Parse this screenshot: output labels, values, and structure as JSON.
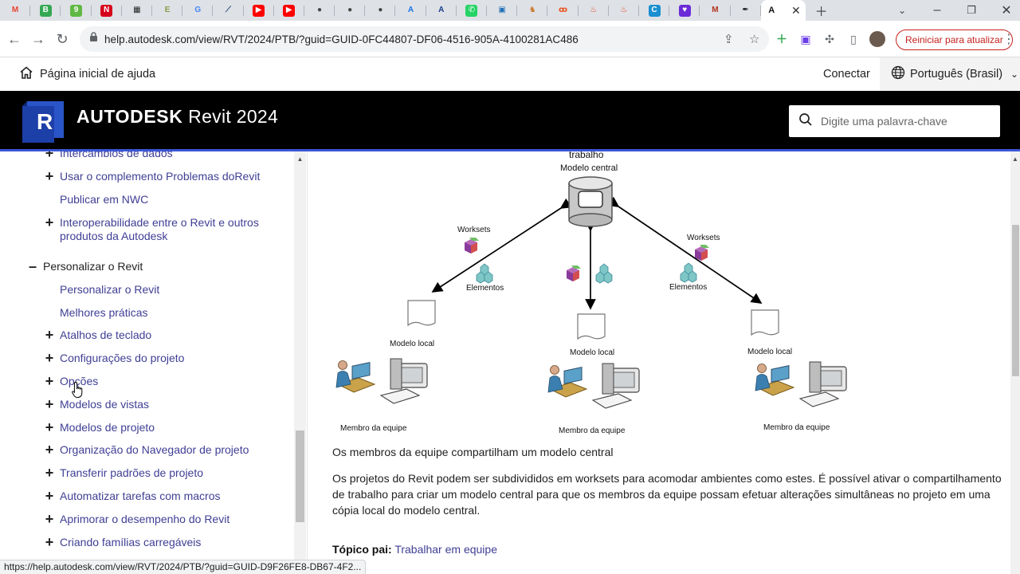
{
  "browser": {
    "tabs": [
      {
        "icon": "gmail-icon",
        "glyph": "M",
        "color": "#ea4335",
        "bg": "transparent"
      },
      {
        "icon": "b-site-icon",
        "glyph": "B",
        "color": "#fff",
        "bg": "#34a853"
      },
      {
        "icon": "9-site-icon",
        "glyph": "9",
        "color": "#fff",
        "bg": "#5fb843"
      },
      {
        "icon": "n-site-icon",
        "glyph": "N",
        "color": "#fff",
        "bg": "#d6001c"
      },
      {
        "icon": "grid-site-icon",
        "glyph": "▦",
        "color": "#222",
        "bg": "transparent"
      },
      {
        "icon": "e-site-icon",
        "glyph": "E",
        "color": "#8b9b4c",
        "bg": "transparent"
      },
      {
        "icon": "google-icon",
        "glyph": "G",
        "color": "#4285f4",
        "bg": "transparent"
      },
      {
        "icon": "stripe-site-icon",
        "glyph": "⟋",
        "color": "#2b4a7a",
        "bg": "transparent"
      },
      {
        "icon": "youtube-icon",
        "glyph": "▶",
        "color": "#fff",
        "bg": "#ff0000"
      },
      {
        "icon": "youtube-icon",
        "glyph": "▶",
        "color": "#fff",
        "bg": "#ff0000"
      },
      {
        "icon": "github-icon",
        "glyph": "●",
        "color": "#444",
        "bg": "transparent"
      },
      {
        "icon": "github-icon",
        "glyph": "●",
        "color": "#444",
        "bg": "transparent"
      },
      {
        "icon": "github-icon",
        "glyph": "●",
        "color": "#444",
        "bg": "transparent"
      },
      {
        "icon": "a-site-icon",
        "glyph": "A",
        "color": "#1a73e8",
        "bg": "transparent"
      },
      {
        "icon": "a-site-icon",
        "glyph": "A",
        "color": "#1a3d8a",
        "bg": "transparent"
      },
      {
        "icon": "whatsapp-icon",
        "glyph": "✆",
        "color": "#fff",
        "bg": "#25d366"
      },
      {
        "icon": "monitor-site-icon",
        "glyph": "▣",
        "color": "#1f6fb5",
        "bg": "transparent"
      },
      {
        "icon": "person-site-icon",
        "glyph": "♞",
        "color": "#c97d2e",
        "bg": "transparent"
      },
      {
        "icon": "c-site-icon",
        "glyph": "ꝏ",
        "color": "#e8541f",
        "bg": "transparent"
      },
      {
        "icon": "drop-site-icon",
        "glyph": "♨",
        "color": "#e8401c",
        "bg": "transparent"
      },
      {
        "icon": "drop-site-icon",
        "glyph": "♨",
        "color": "#e8401c",
        "bg": "transparent"
      },
      {
        "icon": "c-site-icon",
        "glyph": "C",
        "color": "#fff",
        "bg": "#1a8fd1"
      },
      {
        "icon": "heart-site-icon",
        "glyph": "♥",
        "color": "#fff",
        "bg": "#6c2bd9"
      },
      {
        "icon": "m-site-icon",
        "glyph": "M",
        "color": "#b5341f",
        "bg": "transparent"
      },
      {
        "icon": "pen-site-icon",
        "glyph": "✒",
        "color": "#111",
        "bg": "transparent"
      }
    ],
    "active_tab": {
      "icon": "autodesk-icon",
      "glyph": "A"
    },
    "url": "help.autodesk.com/view/RVT/2024/PTB/?guid=GUID-0FC44807-DF06-4516-905A-4100281AC486",
    "restart_label": "Reiniciar para atualizar",
    "status_url": "https://help.autodesk.com/view/RVT/2024/PTB/?guid=GUID-D9F26FE8-DB67-4F2..."
  },
  "helpnav": {
    "home_label": "Página inicial de ajuda",
    "connect_label": "Conectar",
    "language_label": "Português (Brasil)"
  },
  "banner": {
    "logo_letter": "R",
    "brand": "AUTODESK",
    "product": "Revit 2024",
    "search_placeholder": "Digite uma palavra-chave",
    "accent_color": "#3b57d6"
  },
  "toc": [
    {
      "label": "Intercâmbios de dados",
      "expander": "+",
      "level": 2
    },
    {
      "label": "Usar o complemento Problemas doRevit",
      "expander": "+",
      "level": 2
    },
    {
      "label": "Publicar em NWC",
      "expander": "",
      "level": 2
    },
    {
      "label": "Interoperabilidade entre o Revit e outros produtos da Autodesk",
      "expander": "+",
      "level": 2
    },
    {
      "label": "Personalizar o Revit",
      "expander": "–",
      "level": 1
    },
    {
      "label": "Personalizar o Revit",
      "expander": "",
      "level": 2
    },
    {
      "label": "Melhores práticas",
      "expander": "",
      "level": 2
    },
    {
      "label": "Atalhos de teclado",
      "expander": "+",
      "level": 2
    },
    {
      "label": "Configurações do projeto",
      "expander": "+",
      "level": 2
    },
    {
      "label": "Opções",
      "expander": "+",
      "level": 2
    },
    {
      "label": "Modelos de vistas",
      "expander": "+",
      "level": 2
    },
    {
      "label": "Modelos de projeto",
      "expander": "+",
      "level": 2
    },
    {
      "label": "Organização do Navegador de projeto",
      "expander": "+",
      "level": 2
    },
    {
      "label": "Transferir padrões de projeto",
      "expander": "+",
      "level": 2
    },
    {
      "label": "Automatizar tarefas com macros",
      "expander": "+",
      "level": 2
    },
    {
      "label": "Aprimorar o desempenho do Revit",
      "expander": "+",
      "level": 2
    },
    {
      "label": "Criando famílias carregáveis",
      "expander": "+",
      "level": 2
    }
  ],
  "diagram": {
    "central_label_top": "trabalho",
    "central_label": "Modelo central",
    "worksets_label": "Worksets",
    "elements_label": "Elementos",
    "local_model_label": "Modelo local",
    "member_label": "Membro da equipe"
  },
  "content": {
    "caption": "Os membros da equipe compartilham um modelo central",
    "paragraph": "Os projetos do Revit podem ser subdivididos em worksets para acomodar ambientes como estes. É possível ativar o compartilhamento de trabalho para criar um modelo central para que os membros da equipe possam efetuar alterações simultâneas no projeto em uma cópia local do modelo central.",
    "parent_label": "Tópico pai:",
    "parent_link": "Trabalhar em equipe"
  }
}
